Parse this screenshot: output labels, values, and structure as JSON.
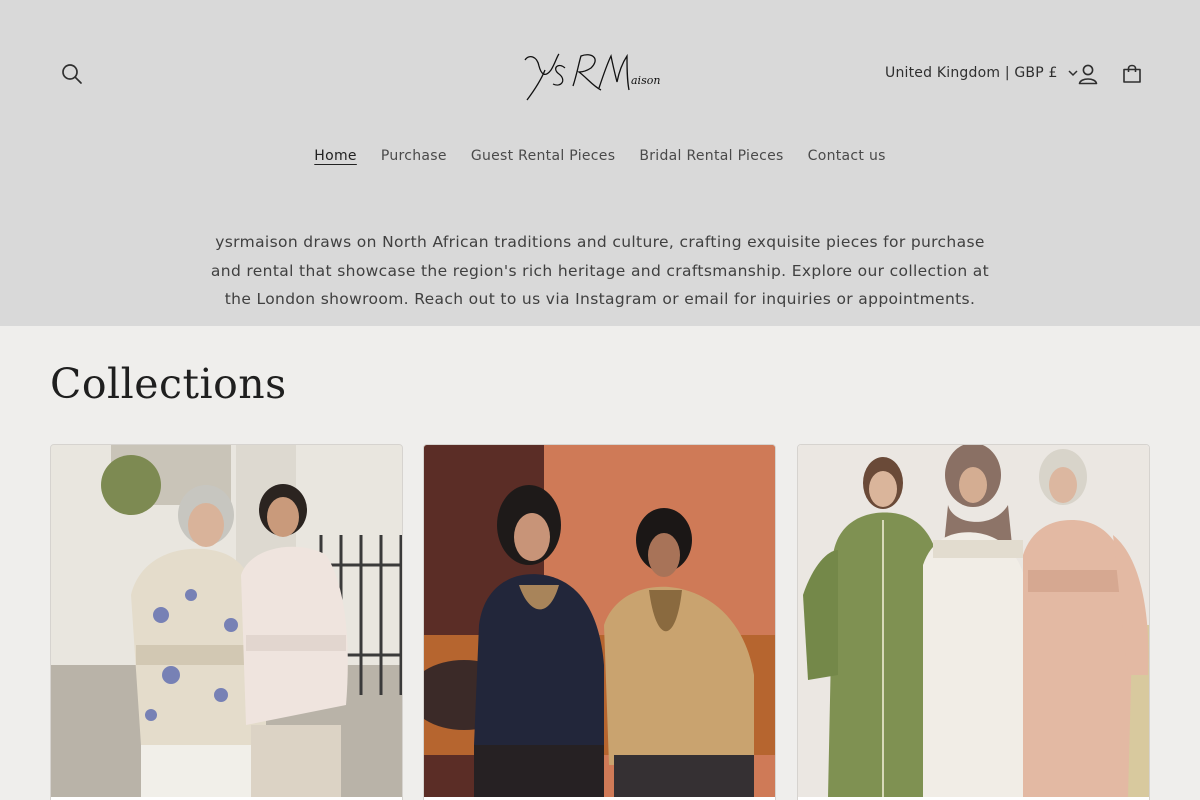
{
  "header": {
    "brand": "YSRMaison",
    "search_icon": "search-icon",
    "locale_label": "United Kingdom | GBP £",
    "account_icon": "account-icon",
    "cart_icon": "cart-icon"
  },
  "nav": {
    "items": [
      {
        "label": "Home",
        "active": true
      },
      {
        "label": "Purchase",
        "active": false
      },
      {
        "label": "Guest Rental Pieces",
        "active": false
      },
      {
        "label": "Bridal Rental Pieces",
        "active": false
      },
      {
        "label": "Contact us",
        "active": false
      }
    ]
  },
  "intro": {
    "text": "ysrmaison draws on North African traditions and culture, crafting exquisite pieces for purchase and rental that showcase the region's rich heritage and craftsmanship. Explore our collection at the London showroom. Reach out to us via Instagram or email for inquiries or appointments."
  },
  "collections": {
    "title": "Collections"
  },
  "colors": {
    "header_bg": "#d9d9d9",
    "page_bg": "#efeeec",
    "text": "#3a3a3a"
  }
}
